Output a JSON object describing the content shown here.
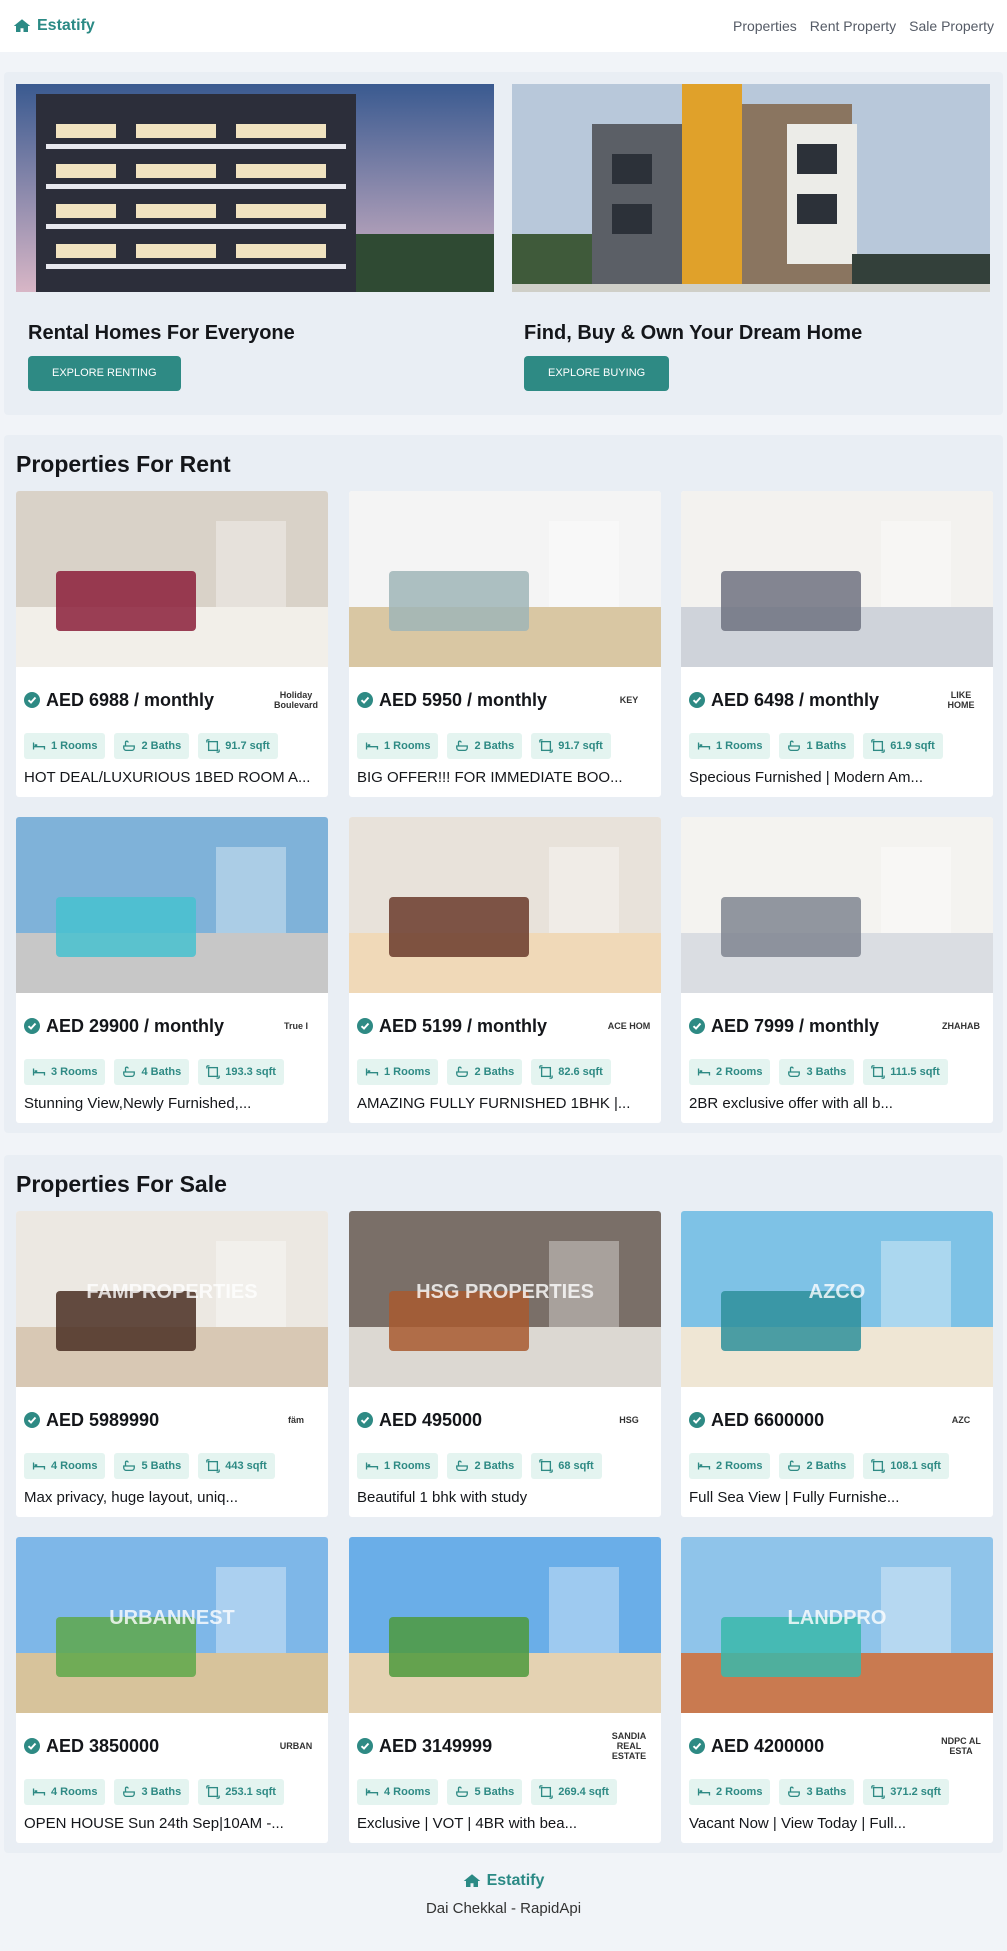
{
  "nav": {
    "brand": "Estatify",
    "links": [
      "Properties",
      "Rent Property",
      "Sale Property"
    ]
  },
  "hero": [
    {
      "title": "Rental Homes For Everyone",
      "button": "EXPLORE RENTING"
    },
    {
      "title": "Find, Buy & Own Your Dream Home",
      "button": "EXPLORE BUYING"
    }
  ],
  "rent": {
    "heading": "Properties For Rent",
    "items": [
      {
        "price": "AED 6988 / monthly",
        "rooms": "1 Rooms",
        "baths": "2 Baths",
        "area": "91.7 sqft",
        "title": "HOT DEAL/LUXURIOUS 1BED ROOM A...",
        "logo": "Holiday Boulevard"
      },
      {
        "price": "AED 5950 / monthly",
        "rooms": "1 Rooms",
        "baths": "2 Baths",
        "area": "91.7 sqft",
        "title": "BIG OFFER!!! FOR IMMEDIATE BOO...",
        "logo": "KEY"
      },
      {
        "price": "AED 6498 / monthly",
        "rooms": "1 Rooms",
        "baths": "1 Baths",
        "area": "61.9 sqft",
        "title": "Specious Furnished | Modern Am...",
        "logo": "LIKE HOME"
      },
      {
        "price": "AED 29900 / monthly",
        "rooms": "3 Rooms",
        "baths": "4 Baths",
        "area": "193.3 sqft",
        "title": "Stunning View,Newly Furnished,...",
        "logo": "True I"
      },
      {
        "price": "AED 5199 / monthly",
        "rooms": "1 Rooms",
        "baths": "2 Baths",
        "area": "82.6 sqft",
        "title": "AMAZING FULLY FURNISHED 1BHK |...",
        "logo": "ACE HOM"
      },
      {
        "price": "AED 7999 / monthly",
        "rooms": "2 Rooms",
        "baths": "3 Baths",
        "area": "111.5 sqft",
        "title": "2BR exclusive offer with all b...",
        "logo": "ZHAHAB"
      }
    ]
  },
  "sale": {
    "heading": "Properties For Sale",
    "items": [
      {
        "price": "AED 5989990",
        "rooms": "4 Rooms",
        "baths": "5 Baths",
        "area": "443 sqft",
        "title": "Max privacy, huge layout, uniq...",
        "logo": "fäm"
      },
      {
        "price": "AED 495000",
        "rooms": "1 Rooms",
        "baths": "2 Baths",
        "area": "68 sqft",
        "title": "Beautiful 1 bhk with study",
        "logo": "HSG"
      },
      {
        "price": "AED 6600000",
        "rooms": "2 Rooms",
        "baths": "2 Baths",
        "area": "108.1 sqft",
        "title": "Full Sea View | Fully Furnishe...",
        "logo": "AZC"
      },
      {
        "price": "AED 3850000",
        "rooms": "4 Rooms",
        "baths": "3 Baths",
        "area": "253.1 sqft",
        "title": "OPEN HOUSE Sun 24th Sep|10AM -...",
        "logo": "URBAN"
      },
      {
        "price": "AED 3149999",
        "rooms": "4 Rooms",
        "baths": "5 Baths",
        "area": "269.4 sqft",
        "title": "Exclusive | VOT | 4BR with bea...",
        "logo": "SANDIA REAL ESTATE"
      },
      {
        "price": "AED 4200000",
        "rooms": "2 Rooms",
        "baths": "3 Baths",
        "area": "371.2 sqft",
        "title": "Vacant Now | View Today | Full...",
        "logo": "NDPC AL ESTA"
      }
    ]
  },
  "photo_watermarks": {
    "sale_0": "FAMPROPERTIES",
    "sale_1": "HSG PROPERTIES",
    "sale_2": "AZCO",
    "sale_3": "URBANNEST",
    "sale_5": "LANDPRO"
  },
  "footer": {
    "brand": "Estatify",
    "credit": "Dai Chekkal - RapidApi"
  },
  "colors": {
    "accent": "#2e8a84",
    "tag_bg": "#e4f4f0",
    "page_bg": "#f1f4f8"
  },
  "icons": [
    "house-logo-icon",
    "verified-check-icon",
    "bed-icon",
    "bath-icon",
    "area-icon"
  ]
}
